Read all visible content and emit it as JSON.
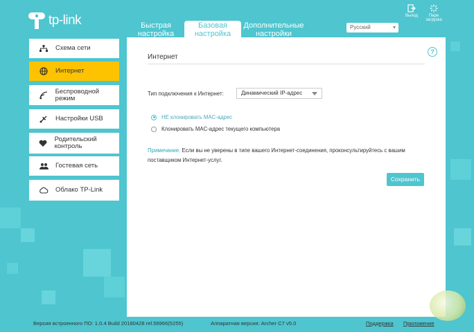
{
  "header": {
    "logo_text": "tp-link",
    "tabs": [
      {
        "label": "Быстрая\nнастройка"
      },
      {
        "label": "Базовая\nнастройка"
      },
      {
        "label": "Дополнительные\nнастройки"
      }
    ],
    "language": "Русский",
    "exit_label": "Выход",
    "reboot_label": "Пере загрузка"
  },
  "sidebar": {
    "items": [
      {
        "label": "Схема сети",
        "icon": "network-map-icon"
      },
      {
        "label": "Интернет",
        "icon": "globe-icon"
      },
      {
        "label": "Беспроводной режим",
        "icon": "wireless-icon"
      },
      {
        "label": "Настройки USB",
        "icon": "usb-icon"
      },
      {
        "label": "Родительский контроль",
        "icon": "parental-control-icon"
      },
      {
        "label": "Гостевая сеть",
        "icon": "guest-network-icon"
      },
      {
        "label": "Облако TP-Link",
        "icon": "cloud-icon"
      }
    ]
  },
  "main": {
    "title": "Интернет",
    "connection_type_label": "Тип подключения к Интернет:",
    "connection_type_value": "Динамический IP-адрес",
    "radio_options": [
      {
        "label": "НЕ клонировать MAC-адрес",
        "selected": true
      },
      {
        "label": "Клонировать MAC-адрес текущего компьютера",
        "selected": false
      }
    ],
    "note_label": "Примечание:",
    "note_text": "Если вы не уверены в типе вашего Интернет-соединения, проконсультируйтесь с вашим поставщиком Интернет-услуг.",
    "save_label": "Сохранить"
  },
  "footer": {
    "firmware": "Версия встроенного ПО: 1.0.4 Build 20180428 rel.56966(5255)",
    "hardware": "Аппаратная версия: Archer C7 v5.0",
    "support_label": "Поддержка",
    "app_label": "Приложение"
  },
  "colors": {
    "accent": "#4ec5cf",
    "active_item": "#fdc300"
  }
}
